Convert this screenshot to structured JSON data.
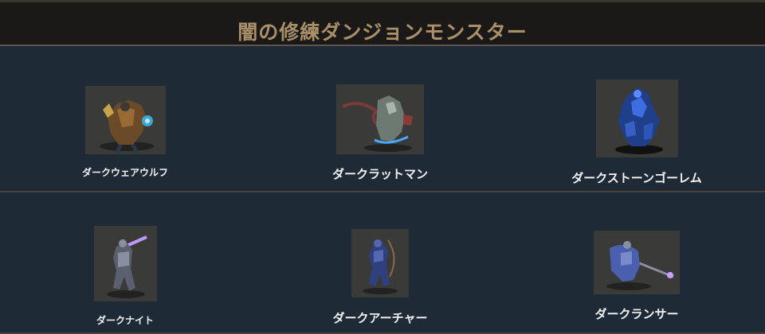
{
  "page": {
    "title": "闇の修練ダンジョンモンスター"
  },
  "monsters": [
    {
      "name": "ダークウェアウルフ",
      "sprite": "werewolf-sprite"
    },
    {
      "name": "ダークラットマン",
      "sprite": "ratman-sprite"
    },
    {
      "name": "ダークストーンゴーレム",
      "sprite": "stone-golem-sprite"
    },
    {
      "name": "ダークナイト",
      "sprite": "knight-sprite"
    },
    {
      "name": "ダークアーチャー",
      "sprite": "archer-sprite"
    },
    {
      "name": "ダークランサー",
      "sprite": "lancer-sprite"
    }
  ],
  "colors": {
    "background": "#1f2a37",
    "header_background": "#1b1917",
    "title": "#a99068",
    "label": "#f2f2f2",
    "thumb_background": "#3a3a38"
  }
}
